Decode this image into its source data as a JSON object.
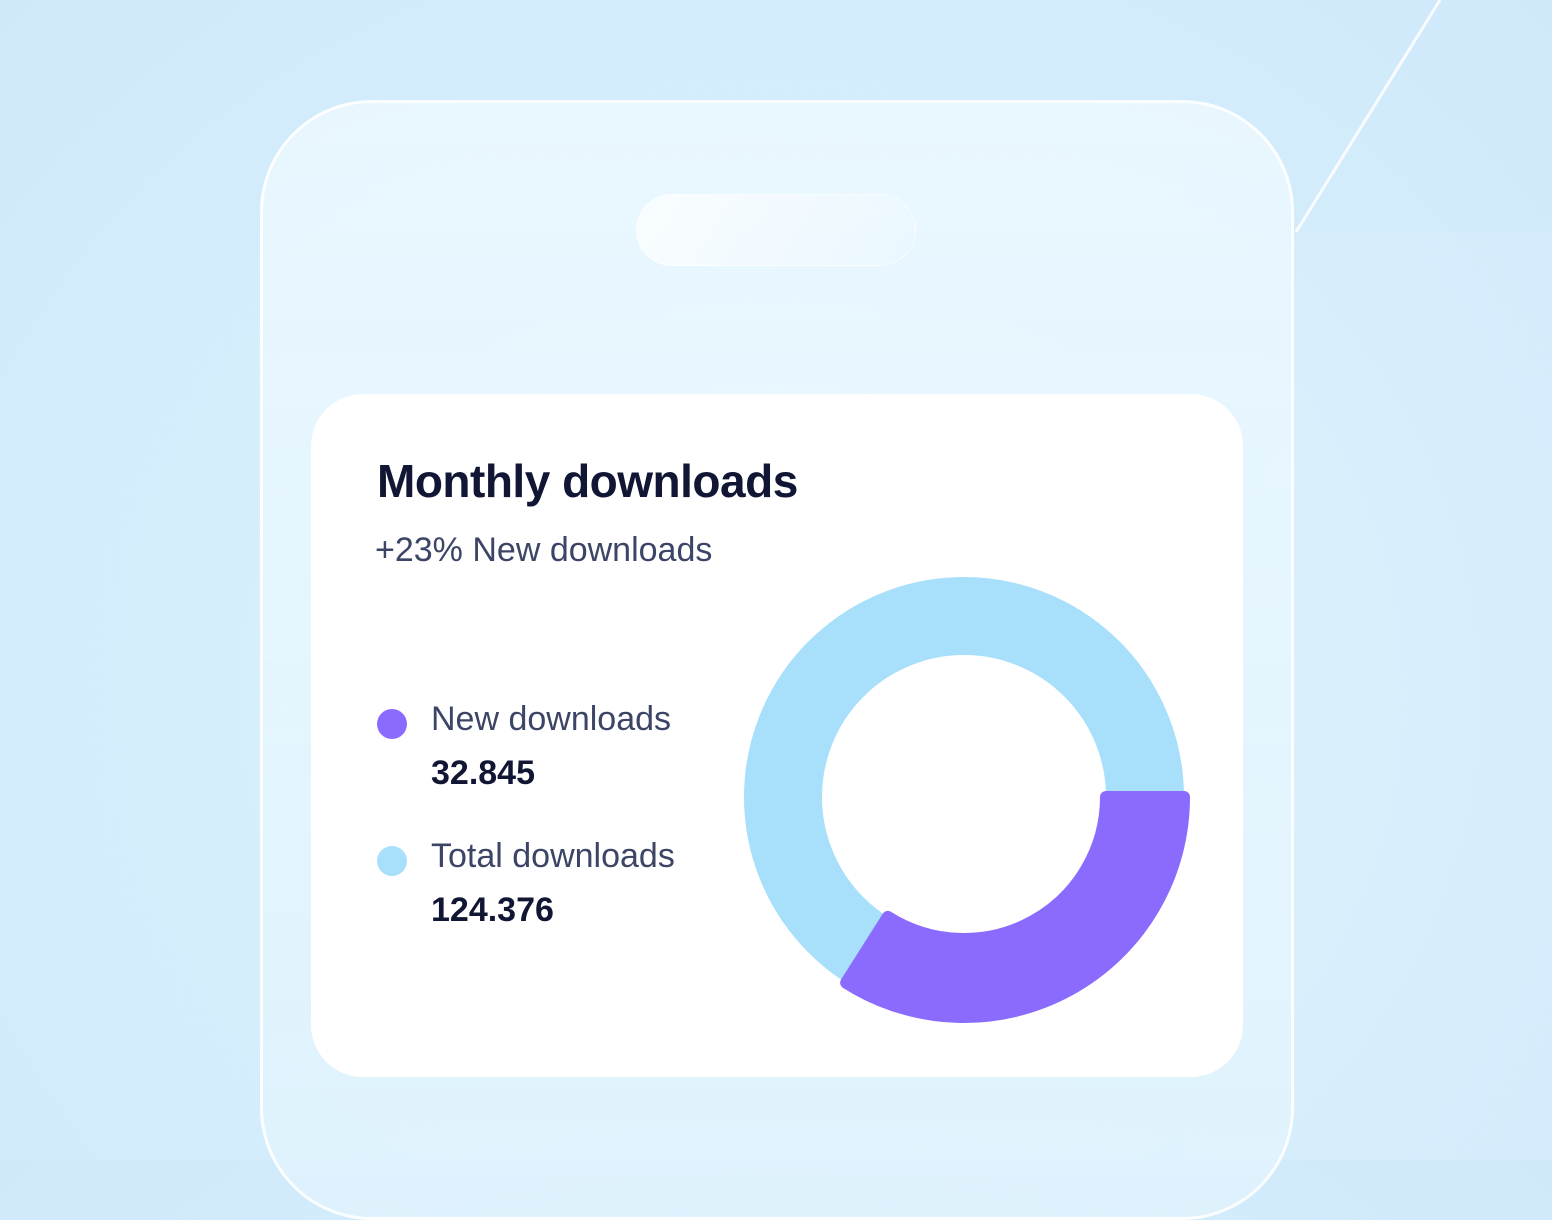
{
  "card": {
    "title": "Monthly downloads",
    "subtitle": "+23% New downloads"
  },
  "legend": [
    {
      "label": "New downloads",
      "value": "32.845",
      "color": "#8a6bfd",
      "icon": "purple-dot-icon"
    },
    {
      "label": "Total downloads",
      "value": "124.376",
      "color": "#a8dffb",
      "icon": "light-blue-dot-icon"
    }
  ],
  "chart_data": {
    "type": "pie",
    "variant": "donut",
    "segments": [
      {
        "name": "New downloads",
        "value": 32845,
        "color": "#8a6bfd"
      },
      {
        "name": "Total downloads",
        "value": 124376,
        "color": "#a8dffb"
      }
    ],
    "new_downloads_fraction": 0.34,
    "start": "3 o'clock, clockwise"
  }
}
